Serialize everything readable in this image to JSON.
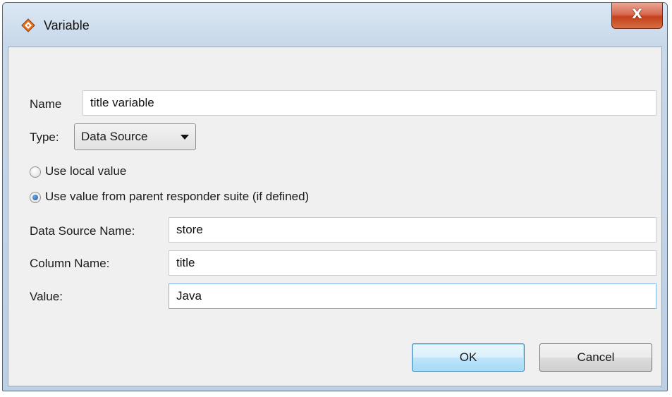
{
  "window": {
    "title": "Variable",
    "close_glyph": "X"
  },
  "form": {
    "name_label": "Name",
    "name_value": "title variable",
    "type_label": "Type:",
    "type_selected": "Data Source",
    "radio_local_label": "Use local value",
    "radio_local_checked": false,
    "radio_parent_label": "Use value from parent responder suite (if defined)",
    "radio_parent_checked": true,
    "data_source_label": "Data Source Name:",
    "data_source_value": "store",
    "column_label": "Column Name:",
    "column_value": "title",
    "value_label": "Value:",
    "value_value": "Java"
  },
  "buttons": {
    "ok": "OK",
    "cancel": "Cancel"
  },
  "colors": {
    "icon_orange": "#e8731c",
    "default_button_border": "#3c7fb1",
    "focus_border": "#7eb4ea"
  },
  "icons": [
    "app-icon",
    "close-icon",
    "dropdown-arrow-icon"
  ]
}
